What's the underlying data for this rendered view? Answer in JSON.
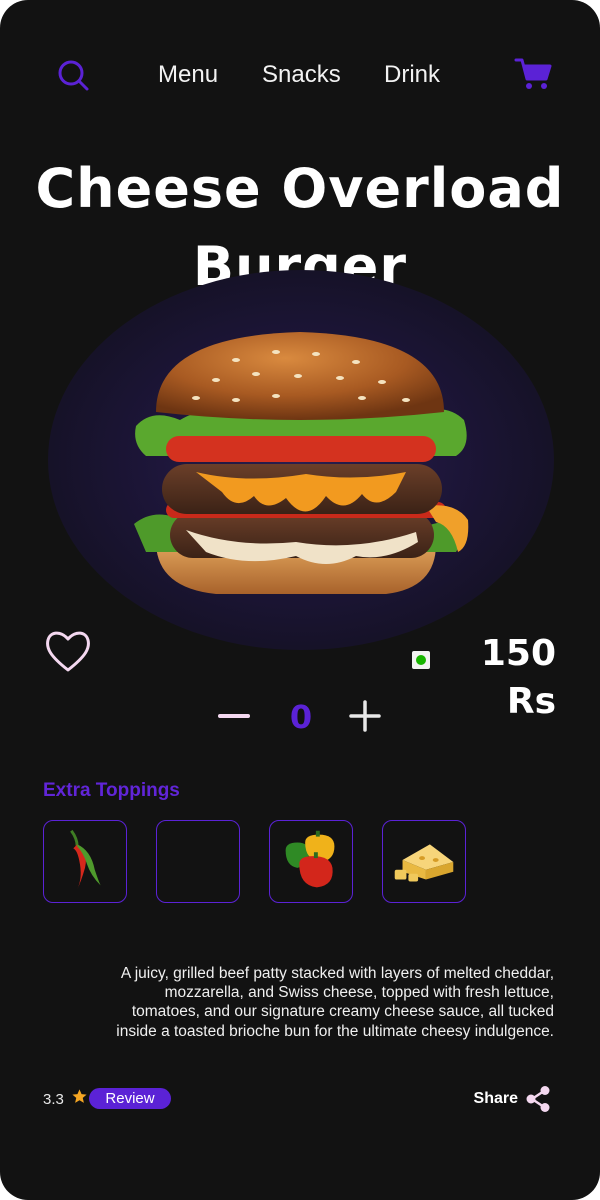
{
  "nav": {
    "search_icon": "search-icon",
    "links": [
      "Menu",
      "Snacks",
      "Drink"
    ],
    "cart_icon": "cart-icon"
  },
  "product": {
    "title_line1": "Cheese Overload",
    "title_line2": "Burger",
    "image": "burger-image",
    "price": "150 Rs",
    "veg_indicator": "veg-mark",
    "quantity": "0"
  },
  "toppings": {
    "title": "Extra Toppings",
    "items": [
      "chilli-pepper",
      "empty",
      "bell-peppers",
      "cheese"
    ]
  },
  "description": "A juicy, grilled beef patty stacked with layers of melted cheddar, mozzarella, and Swiss cheese, topped with fresh lettuce, tomatoes, and our signature creamy cheese sauce, all tucked inside a toasted brioche bun for the ultimate cheesy indulgence.",
  "footer": {
    "rating": "3.3",
    "review_label": "Review",
    "share_label": "Share"
  },
  "colors": {
    "background": "#121212",
    "accent": "#5b22d6",
    "veg": "#18b400",
    "star": "#f5a623"
  }
}
